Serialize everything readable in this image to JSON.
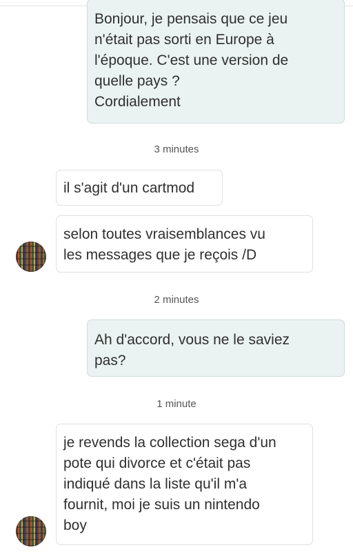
{
  "messages": [
    {
      "direction": "outgoing",
      "text": "Bonjour, je pensais que ce jeu\nn'était pas sorti en Europe à\nl'époque. C'est une version de\nquelle pays ?\nCordialement"
    },
    {
      "direction": "incoming",
      "text": "il s'agit d'un cartmod"
    },
    {
      "direction": "incoming",
      "text": "selon toutes vraisemblances vu\nles messages que je reçois /D"
    },
    {
      "direction": "outgoing",
      "text": "Ah d'accord, vous ne le saviez\npas?"
    },
    {
      "direction": "incoming",
      "text": "je revends la collection sega d'un\npote qui divorce et c'était pas\nindiqué dans la liste qu'il m'a\nfournit, moi je suis un nintendo\nboy"
    }
  ],
  "timestamps": [
    "3 minutes",
    "2 minutes",
    "1 minute"
  ],
  "avatar_icon": "user-avatar-photo"
}
